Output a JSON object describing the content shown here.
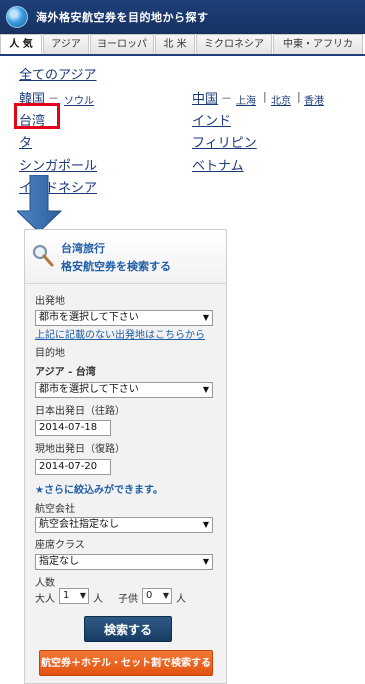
{
  "header": {
    "title": "海外格安航空券を目的地から探す"
  },
  "tabs": [
    "人 気",
    "アジア",
    "ヨーロッパ",
    "北 米",
    "ミクロネシア",
    "中東・アフリカ"
  ],
  "region": {
    "all_asia": "全てのアジア",
    "korea": "韓国",
    "seoul": "ソウル",
    "china": "中国",
    "shanghai": "上海",
    "beijing": "北京",
    "hongkong": "香港",
    "taiwan": "台湾",
    "india": "インド",
    "thailand": "タ",
    "philippines": "フィリピン",
    "singapore": "シンガポール",
    "vietnam": "ベトナム",
    "indonesia": "インドネシア",
    "dash": "－",
    "bar": "|"
  },
  "panel": {
    "title_line1": "台湾旅行",
    "title_line2": "格安航空券を検索する",
    "departure_label": "出発地",
    "departure_value": "都市を選択して下さい",
    "departure_link": "上記に記載のない出発地はこちらから",
    "destination_label": "目的地",
    "destination_value": "アジア - 台湾",
    "destination_city": "都市を選択して下さい",
    "depart_date_label": "日本出発日（往路）",
    "depart_date": "2014-07-18",
    "return_date_label": "現地出発日（復路）",
    "return_date": "2014-07-20",
    "narrow_note": "★さらに絞込みができます。",
    "airline_label": "航空会社",
    "airline_value": "航空会社指定なし",
    "class_label": "座席クラス",
    "class_value": "指定なし",
    "people_label": "人数",
    "adult_label": "大人",
    "adult_count": "1",
    "person_unit": "人",
    "child_label": "子供",
    "child_count": "0",
    "search_button": "検索する",
    "combo_button": "航空券＋ホテル・セット割で検索する"
  }
}
